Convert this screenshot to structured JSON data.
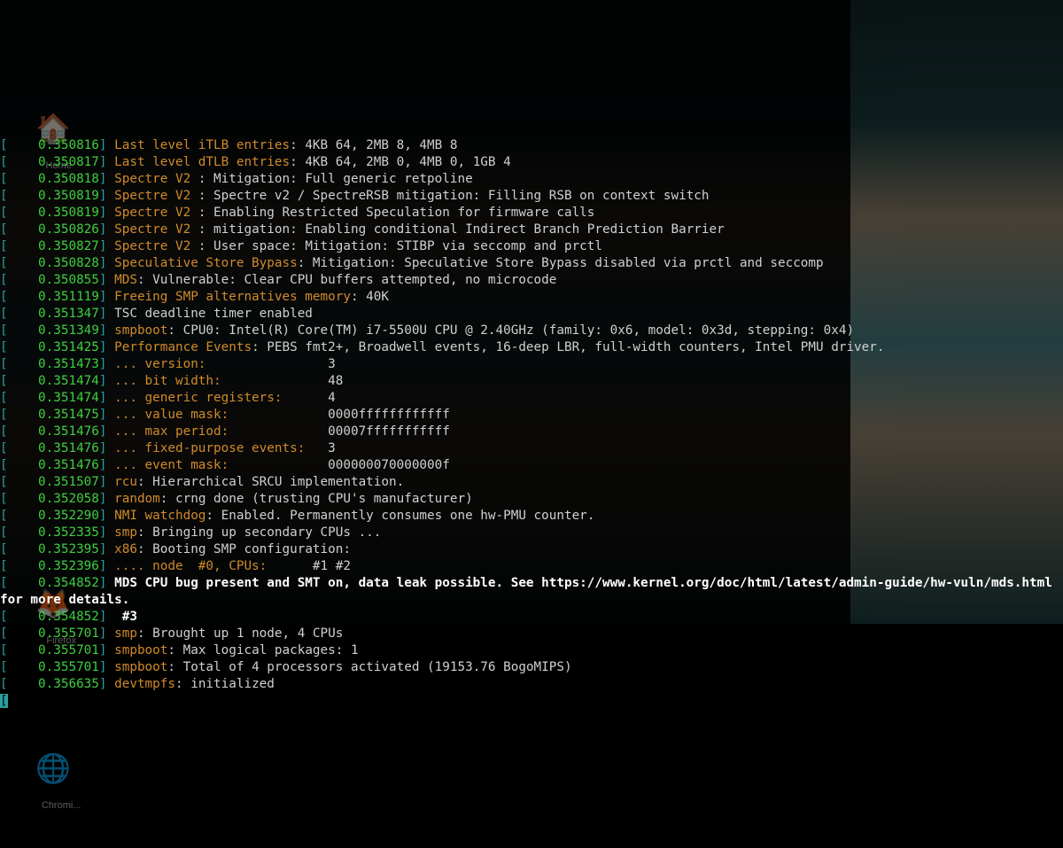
{
  "desktop_icons": {
    "home": "Home",
    "firefox": "Firefox",
    "chromium": "Chromi...",
    "chromium2": "Chromi..."
  },
  "colors": {
    "bracket": "#28a0a0",
    "timestamp": "#3ecf3e",
    "subsystem": "#d08a2a",
    "message": "#d0d0d0",
    "bold": "#ffffff"
  },
  "log": [
    {
      "ts": "0.350816",
      "sub": "Last level iTLB entries",
      "msg": ": 4KB 64, 2MB 8, 4MB 8"
    },
    {
      "ts": "0.350817",
      "sub": "Last level dTLB entries",
      "msg": ": 4KB 64, 2MB 0, 4MB 0, 1GB 4"
    },
    {
      "ts": "0.350818",
      "sub": "Spectre V2 ",
      "msg": ": Mitigation: Full generic retpoline"
    },
    {
      "ts": "0.350819",
      "sub": "Spectre V2 ",
      "msg": ": Spectre v2 / SpectreRSB mitigation: Filling RSB on context switch"
    },
    {
      "ts": "0.350819",
      "sub": "Spectre V2 ",
      "msg": ": Enabling Restricted Speculation for firmware calls"
    },
    {
      "ts": "0.350826",
      "sub": "Spectre V2 ",
      "msg": ": mitigation: Enabling conditional Indirect Branch Prediction Barrier"
    },
    {
      "ts": "0.350827",
      "sub": "Spectre V2 ",
      "msg": ": User space: Mitigation: STIBP via seccomp and prctl"
    },
    {
      "ts": "0.350828",
      "sub": "Speculative Store Bypass",
      "msg": ": Mitigation: Speculative Store Bypass disabled via prctl and seccomp"
    },
    {
      "ts": "0.350855",
      "sub": "MDS",
      "msg": ": Vulnerable: Clear CPU buffers attempted, no microcode"
    },
    {
      "ts": "0.351119",
      "sub": "Freeing SMP alternatives memory",
      "msg": ": 40K"
    },
    {
      "ts": "0.351347",
      "sub": "",
      "msg": "TSC deadline timer enabled"
    },
    {
      "ts": "0.351349",
      "sub": "smpboot",
      "msg": ": CPU0: Intel(R) Core(TM) i7-5500U CPU @ 2.40GHz (family: 0x6, model: 0x3d, stepping: 0x4)"
    },
    {
      "ts": "0.351425",
      "sub": "Performance Events",
      "msg": ": PEBS fmt2+, Broadwell events, 16-deep LBR, full-width counters, Intel PMU driver."
    },
    {
      "ts": "0.351473",
      "sub": "... version:               ",
      "msg": " 3"
    },
    {
      "ts": "0.351474",
      "sub": "... bit width:             ",
      "msg": " 48"
    },
    {
      "ts": "0.351474",
      "sub": "... generic registers:     ",
      "msg": " 4"
    },
    {
      "ts": "0.351475",
      "sub": "... value mask:            ",
      "msg": " 0000ffffffffffff"
    },
    {
      "ts": "0.351476",
      "sub": "... max period:            ",
      "msg": " 00007fffffffffff"
    },
    {
      "ts": "0.351476",
      "sub": "... fixed-purpose events:  ",
      "msg": " 3"
    },
    {
      "ts": "0.351476",
      "sub": "... event mask:            ",
      "msg": " 000000070000000f"
    },
    {
      "ts": "0.351507",
      "sub": "rcu",
      "msg": ": Hierarchical SRCU implementation."
    },
    {
      "ts": "0.352058",
      "sub": "random",
      "msg": ": crng done (trusting CPU's manufacturer)"
    },
    {
      "ts": "0.352290",
      "sub": "NMI watchdog",
      "msg": ": Enabled. Permanently consumes one hw-PMU counter."
    },
    {
      "ts": "0.352335",
      "sub": "smp",
      "msg": ": Bringing up secondary CPUs ..."
    },
    {
      "ts": "0.352395",
      "sub": "x86",
      "msg": ": Booting SMP configuration:"
    },
    {
      "ts": "0.352396",
      "sub": ".... node  #0, CPUs:     ",
      "msg": " #1 #2"
    },
    {
      "ts": "0.354852",
      "sub": "",
      "msg": "",
      "bold": "MDS CPU bug present and SMT on, data leak possible. See https://www.kernel.org/doc/html/latest/admin-guide/hw-vuln/mds.html for more details."
    },
    {
      "ts": "0.354852",
      "sub": "",
      "msg": "",
      "bold": " #3"
    },
    {
      "ts": "0.355701",
      "sub": "smp",
      "msg": ": Brought up 1 node, 4 CPUs"
    },
    {
      "ts": "0.355701",
      "sub": "smpboot",
      "msg": ": Max logical packages: 1"
    },
    {
      "ts": "0.355701",
      "sub": "smpboot",
      "msg": ": Total of 4 processors activated (19153.76 BogoMIPS)"
    },
    {
      "ts": "0.356635",
      "sub": "devtmpfs",
      "msg": ": initialized"
    }
  ],
  "cursor_line_prefix": "["
}
